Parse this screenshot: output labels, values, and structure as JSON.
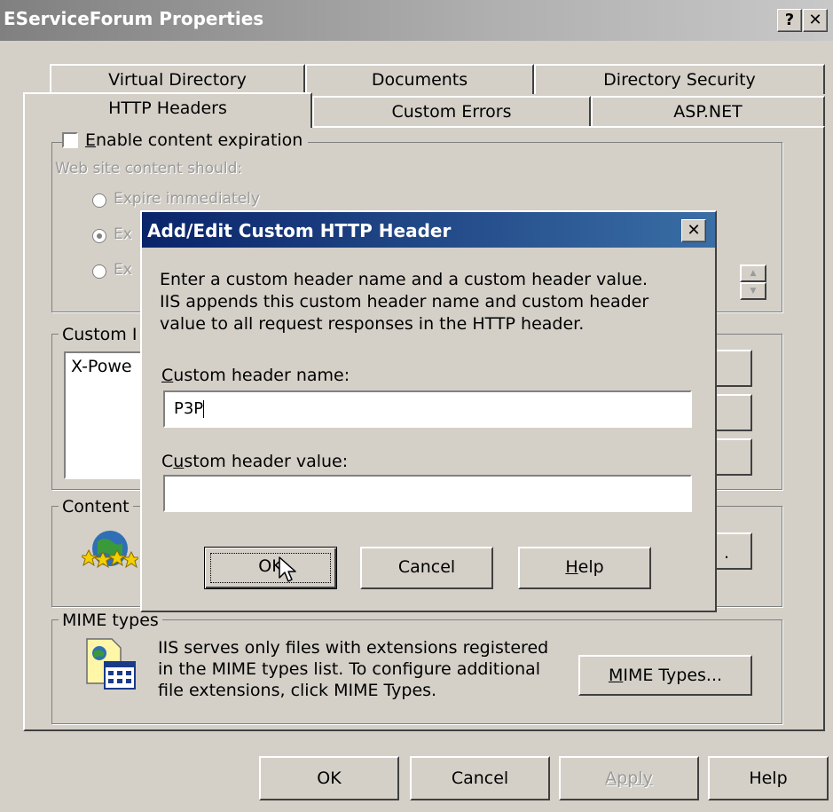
{
  "window": {
    "title": "EServiceForum Properties",
    "help_button": "?",
    "close_button": "✕"
  },
  "tabs": {
    "back_row": [
      "Virtual Directory",
      "Documents",
      "Directory Security"
    ],
    "front_row": [
      "HTTP Headers",
      "Custom Errors",
      "ASP.NET"
    ],
    "active": "HTTP Headers"
  },
  "expiration": {
    "checkbox_label": "Enable content expiration",
    "checkbox_accesskey_label": "E",
    "checkbox_rest_label": "nable content expiration",
    "checked": false,
    "subheading": "Web site content should:",
    "options": [
      {
        "label": "Expire immediately",
        "selected": false
      },
      {
        "label": "Ex",
        "selected": true
      },
      {
        "label": "Ex",
        "selected": false
      }
    ]
  },
  "custom_headers": {
    "legend": "Custom I",
    "list_items": [
      "X-Powe"
    ]
  },
  "content_rating": {
    "legend": "Content",
    "button_label": "."
  },
  "mime": {
    "legend": "MIME types",
    "description_lines": [
      "IIS serves only files with extensions registered",
      "in the MIME types list. To configure additional",
      "file extensions, click MIME Types."
    ],
    "button_label": "MIME Types...",
    "button_accesskey": "M",
    "button_rest": "IME Types..."
  },
  "footer_buttons": {
    "ok": "OK",
    "cancel": "Cancel",
    "apply": "Apply",
    "help": "Help"
  },
  "dialog": {
    "title": "Add/Edit Custom HTTP Header",
    "close": "✕",
    "instructions": [
      "Enter a custom header name and a custom header value.",
      "IIS appends this custom header name and custom header",
      "value to all request responses in the HTTP header."
    ],
    "name_label_accesskey": "C",
    "name_label_rest": "ustom header name:",
    "name_value": "P3P",
    "value_label_pre": "C",
    "value_label_accesskey": "u",
    "value_label_rest": "stom header value:",
    "value_value": "",
    "ok": "OK",
    "cancel": "Cancel",
    "help_accesskey": "H",
    "help_rest": "elp"
  }
}
